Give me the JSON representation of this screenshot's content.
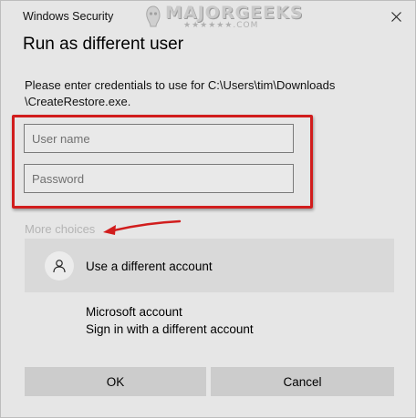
{
  "window": {
    "title": "Windows Security"
  },
  "watermark": {
    "name": "MAJORGEEKS",
    "domain": "★★★★★★.COM"
  },
  "dialog": {
    "heading": "Run as different user",
    "description_line1": "Please enter credentials to use for C:\\Users\\tim\\Downloads",
    "description_line2": "\\CreateRestore.exe."
  },
  "form": {
    "username_placeholder": "User name",
    "username_value": "",
    "password_placeholder": "Password",
    "password_value": ""
  },
  "more_choices": {
    "label": "More choices",
    "options": [
      {
        "label": "Use a different account",
        "icon": "person-icon"
      }
    ],
    "microsoft_title": "Microsoft account",
    "microsoft_subtitle": "Sign in with a different account"
  },
  "buttons": {
    "ok": "OK",
    "cancel": "Cancel"
  },
  "colors": {
    "highlight": "#d11d1d",
    "background": "#e6e6e6",
    "button": "#cccccc"
  }
}
